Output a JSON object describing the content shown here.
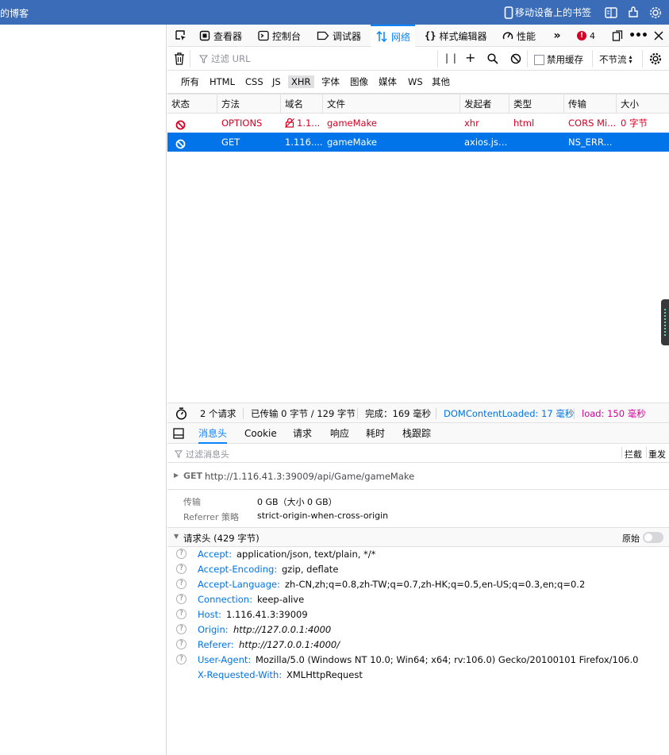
{
  "bookmarks_bar": {
    "left_text": "的博客",
    "mobile_bookmarks": "移动设备上的书签",
    "icons": [
      "mobile-icon",
      "reader-icon",
      "extensions-icon",
      "settings-icon"
    ]
  },
  "devtools": {
    "tabs": [
      {
        "name": "inspector",
        "label": "查看器"
      },
      {
        "name": "console",
        "label": "控制台"
      },
      {
        "name": "debugger",
        "label": "调试器"
      },
      {
        "name": "network",
        "label": "网络",
        "active": true
      },
      {
        "name": "style-editor",
        "label": "样式编辑器"
      },
      {
        "name": "performance",
        "label": "性能"
      }
    ],
    "error_count": "4",
    "filter_placeholder": "过滤 URL",
    "disable_cache_label": "禁用缓存",
    "throttle_label": "不节流",
    "type_filters": [
      "所有",
      "HTML",
      "CSS",
      "JS",
      "XHR",
      "字体",
      "图像",
      "媒体",
      "WS",
      "其他"
    ],
    "active_type": "XHR",
    "columns": [
      "状态",
      "方法",
      "域名",
      "文件",
      "发起者",
      "类型",
      "传输",
      "大小"
    ],
    "rows": [
      {
        "method": "OPTIONS",
        "domain": "1.1...",
        "file": "gameMake",
        "initiator": "xhr",
        "type": "html",
        "transfer": "CORS Mi...",
        "size": "0 字节",
        "selected": false
      },
      {
        "method": "GET",
        "domain": "1.116....",
        "file": "gameMake",
        "initiator": "axios.js:...",
        "type": "",
        "transfer": "NS_ERR...",
        "size": "",
        "selected": true
      }
    ],
    "summary": {
      "requests": "2 个请求",
      "transferred": "已传输 0 字节 / 129 字节",
      "finish": "完成：169 毫秒",
      "dom_loaded": "DOMContentLoaded: 17 毫秒",
      "load": "load: 150 毫秒"
    },
    "detail_tabs": [
      "消息头",
      "Cookie",
      "请求",
      "响应",
      "耗时",
      "栈跟踪"
    ],
    "active_detail_tab": "消息头",
    "detail_filter_placeholder": "过滤消息头",
    "block_label": "拦截",
    "resend_label": "重发",
    "request_method": "GET",
    "request_url": "http://1.116.41.3:39009/api/Game/gameMake",
    "transfer_label": "传输",
    "transfer_value": "0 GB（大小 0 GB）",
    "referrer_label": "Referrer 策略",
    "referrer_value": "strict-origin-when-cross-origin",
    "request_headers_title": "请求头 (429 字节)",
    "raw_label": "原始",
    "headers": [
      {
        "name": "Accept:",
        "value": "application/json, text/plain, */*",
        "italic": false,
        "help": true
      },
      {
        "name": "Accept-Encoding:",
        "value": "gzip, deflate",
        "italic": false,
        "help": true
      },
      {
        "name": "Accept-Language:",
        "value": "zh-CN,zh;q=0.8,zh-TW;q=0.7,zh-HK;q=0.5,en-US;q=0.3,en;q=0.2",
        "italic": false,
        "help": true
      },
      {
        "name": "Connection:",
        "value": "keep-alive",
        "italic": false,
        "help": true
      },
      {
        "name": "Host:",
        "value": "1.116.41.3:39009",
        "italic": false,
        "help": true
      },
      {
        "name": "Origin:",
        "value": "http://127.0.0.1:4000",
        "italic": true,
        "help": true
      },
      {
        "name": "Referer:",
        "value": "http://127.0.0.1:4000/",
        "italic": true,
        "help": true
      },
      {
        "name": "User-Agent:",
        "value": "Mozilla/5.0 (Windows NT 10.0; Win64; x64; rv:106.0) Gecko/20100101 Firefox/106.0",
        "italic": false,
        "help": true
      },
      {
        "name": "X-Requested-With:",
        "value": "XMLHttpRequest",
        "italic": false,
        "help": false
      }
    ]
  }
}
